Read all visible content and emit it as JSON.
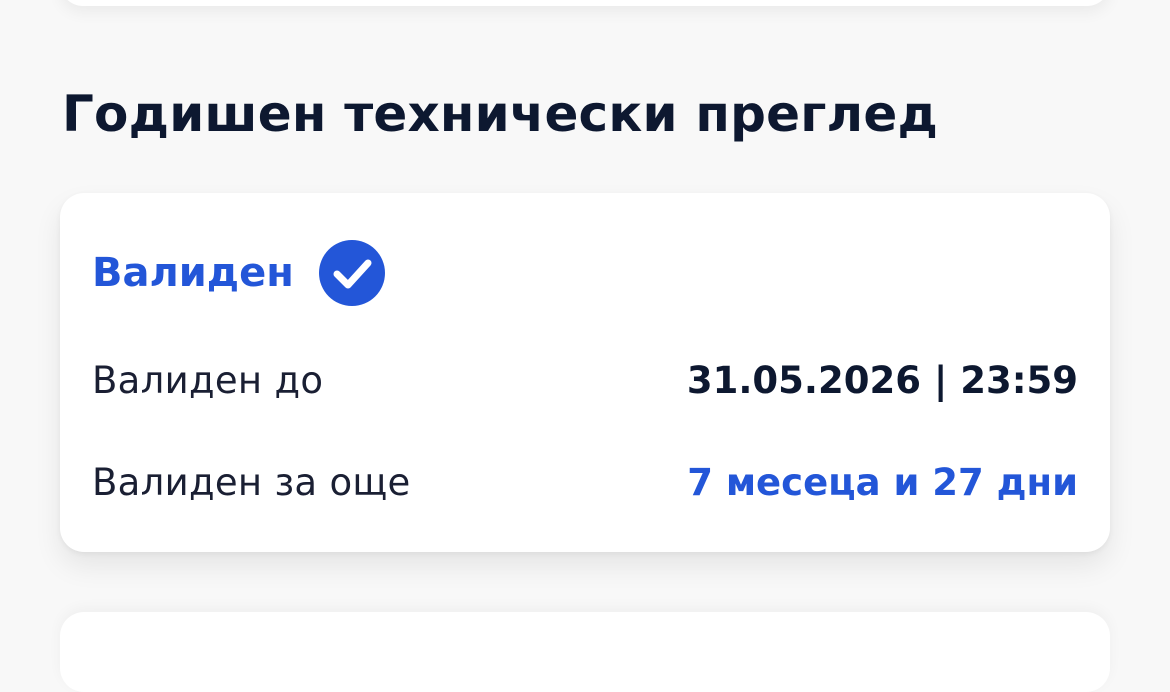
{
  "section": {
    "title": "Годишен технически преглед"
  },
  "card": {
    "status": "Валиден",
    "status_icon": "check-circle-icon",
    "colors": {
      "accent": "#2356d8",
      "text_dark": "#0d1830"
    },
    "rows": [
      {
        "label": "Валиден до",
        "value": "31.05.2026 | 23:59"
      },
      {
        "label": "Валиден за още",
        "value": "7 месеца и 27 дни"
      }
    ]
  }
}
